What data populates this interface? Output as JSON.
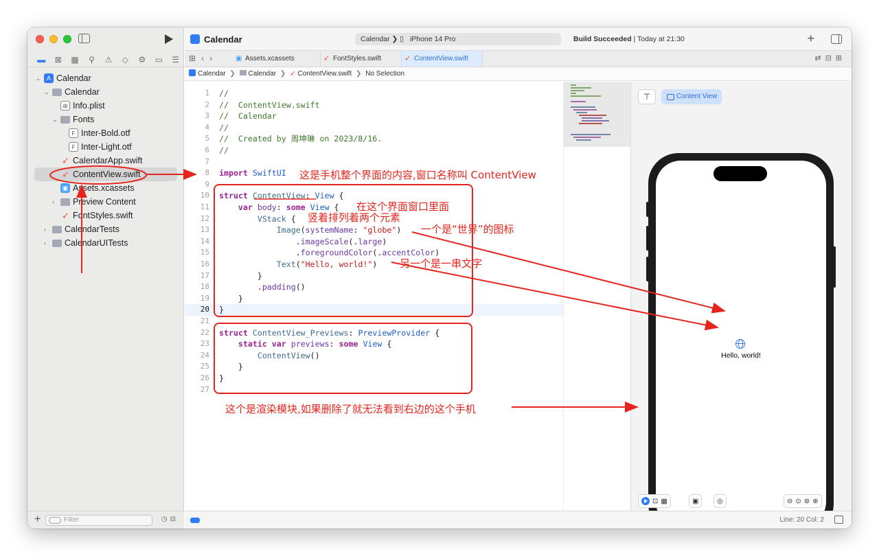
{
  "window": {
    "traffic_lights": [
      "close",
      "minimize",
      "zoom"
    ]
  },
  "toolbar": {
    "title": "Calendar",
    "scheme_target": "Calendar",
    "scheme_device": "iPhone 14 Pro",
    "build_result": "Build Succeeded",
    "build_time": "Today at 21:30"
  },
  "navigator": {
    "tree": [
      {
        "label": "Calendar",
        "icon": "app-icon",
        "level": 0,
        "chevron": "down"
      },
      {
        "label": "Calendar",
        "icon": "folder-icon",
        "level": 1,
        "chevron": "down"
      },
      {
        "label": "Info.plist",
        "icon": "plist-icon",
        "level": 2,
        "chevron": ""
      },
      {
        "label": "Fonts",
        "icon": "folder-icon",
        "level": 2,
        "chevron": "down"
      },
      {
        "label": "Inter-Bold.otf",
        "icon": "font-file-icon",
        "level": 3,
        "chevron": ""
      },
      {
        "label": "Inter-Light.otf",
        "icon": "font-file-icon",
        "level": 3,
        "chevron": ""
      },
      {
        "label": "CalendarApp.swift",
        "icon": "swift-icon",
        "level": 2,
        "chevron": ""
      },
      {
        "label": "ContentView.swift",
        "icon": "swift-icon",
        "level": 2,
        "chevron": "",
        "selected": true
      },
      {
        "label": "Assets.xcassets",
        "icon": "assets-icon",
        "level": 2,
        "chevron": ""
      },
      {
        "label": "Preview Content",
        "icon": "folder-icon",
        "level": 2,
        "chevron": "right"
      },
      {
        "label": "FontStyles.swift",
        "icon": "swift-icon",
        "level": 2,
        "chevron": ""
      },
      {
        "label": "CalendarTests",
        "icon": "folder-icon",
        "level": 1,
        "chevron": "right"
      },
      {
        "label": "CalendarUITests",
        "icon": "folder-icon",
        "level": 1,
        "chevron": "right"
      }
    ],
    "filter_placeholder": "Filter"
  },
  "tabs": [
    {
      "label": "Assets.xcassets",
      "icon": "assets-icon",
      "active": false
    },
    {
      "label": "FontStyles.swift",
      "icon": "swift-icon",
      "active": false
    },
    {
      "label": "ContentView.swift",
      "icon": "swift-icon",
      "active": true
    }
  ],
  "breadcrumb": {
    "items": [
      "Calendar",
      "Calendar",
      "ContentView.swift",
      "No Selection"
    ]
  },
  "editor": {
    "current_line": 20,
    "lines": [
      "//",
      "//  ContentView.swift",
      "//  Calendar",
      "//",
      "//  Created by 周坤琳 on 2023/8/16.",
      "//",
      "",
      "import SwiftUI",
      "",
      "struct ContentView: View {",
      "    var body: some View {",
      "        VStack {",
      "            Image(systemName: \"globe\")",
      "                .imageScale(.large)",
      "                .foregroundColor(.accentColor)",
      "            Text(\"Hello, world!\")",
      "        }",
      "        .padding()",
      "    }",
      "}",
      "",
      "struct ContentView_Previews: PreviewProvider {",
      "    static var previews: some View {",
      "        ContentView()",
      "    }",
      "}",
      ""
    ]
  },
  "canvas": {
    "chip_label": "Content View",
    "preview_text": "Hello, world!",
    "preview_icon": "globe-icon"
  },
  "statusbar": {
    "position": "Line: 20  Col: 2"
  },
  "annotations": {
    "import_note": "这是手机整个界面的内容,窗口名称叫 ContentView",
    "body_note": "在这个界面窗口里面",
    "vstack_note": "竖着排列着两个元素",
    "image_note": "一个是“世界”的图标",
    "text_note": "另一个是一串文字",
    "preview_note": "这个是渲染模块,如果删除了就无法看到右边的这个手机",
    "color": "#e5251d"
  }
}
